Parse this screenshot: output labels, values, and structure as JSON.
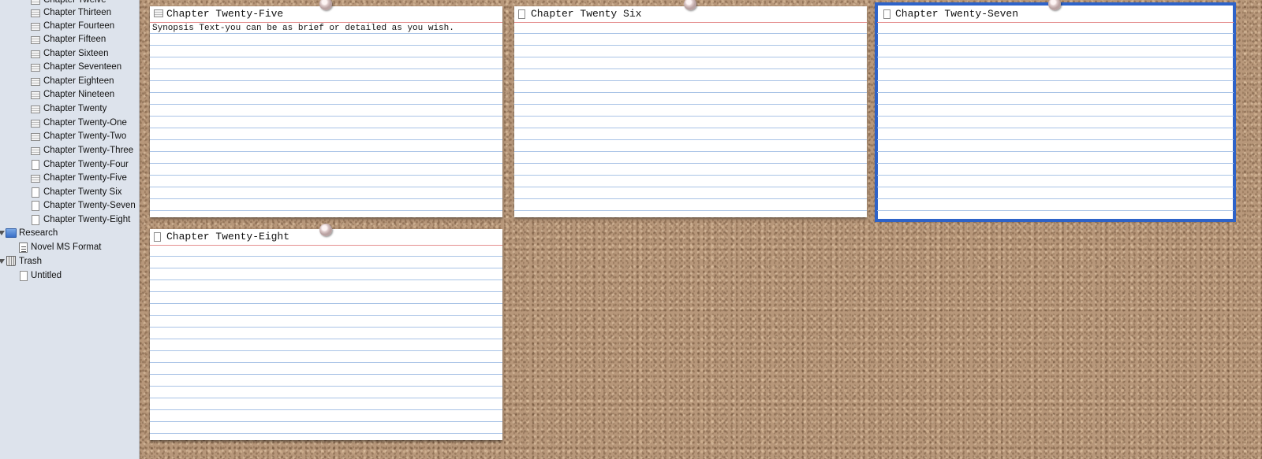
{
  "binder": {
    "items": [
      {
        "label": "Chapter Twelve",
        "icon": "document-lines-icon"
      },
      {
        "label": "Chapter Thirteen",
        "icon": "document-lines-icon"
      },
      {
        "label": "Chapter Fourteen",
        "icon": "document-lines-icon"
      },
      {
        "label": "Chapter Fifteen",
        "icon": "document-lines-icon"
      },
      {
        "label": "Chapter Sixteen",
        "icon": "document-lines-icon"
      },
      {
        "label": "Chapter Seventeen",
        "icon": "document-lines-icon"
      },
      {
        "label": "Chapter Eighteen",
        "icon": "document-lines-icon"
      },
      {
        "label": "Chapter Nineteen",
        "icon": "document-lines-icon"
      },
      {
        "label": "Chapter Twenty",
        "icon": "document-lines-icon"
      },
      {
        "label": "Chapter Twenty-One",
        "icon": "document-lines-icon"
      },
      {
        "label": "Chapter Twenty-Two",
        "icon": "document-lines-icon"
      },
      {
        "label": "Chapter Twenty-Three",
        "icon": "document-lines-icon"
      },
      {
        "label": "Chapter Twenty-Four",
        "icon": "blank-document-icon"
      },
      {
        "label": "Chapter Twenty-Five",
        "icon": "document-lines-icon"
      },
      {
        "label": "Chapter Twenty Six",
        "icon": "blank-document-icon"
      },
      {
        "label": "Chapter Twenty-Seven",
        "icon": "blank-document-icon"
      },
      {
        "label": "Chapter Twenty-Eight",
        "icon": "blank-document-icon"
      }
    ],
    "research": {
      "label": "Research",
      "icon": "research-folder-icon"
    },
    "research_children": [
      {
        "label": "Novel MS Format",
        "icon": "text-document-icon"
      }
    ],
    "trash": {
      "label": "Trash",
      "icon": "trash-icon"
    },
    "trash_children": [
      {
        "label": "Untitled",
        "icon": "blank-document-icon"
      }
    ]
  },
  "corkboard": {
    "cards": [
      {
        "title": "Chapter Twenty-Five",
        "synopsis": "Synopsis Text-you can be as brief or detailed as you wish.",
        "icon": "document-lines-icon",
        "selected": false
      },
      {
        "title": "Chapter Twenty Six",
        "synopsis": "",
        "icon": "blank-document-icon",
        "selected": false
      },
      {
        "title": "Chapter Twenty-Seven",
        "synopsis": "",
        "icon": "blank-document-icon",
        "selected": true
      },
      {
        "title": "Chapter Twenty-Eight",
        "synopsis": "",
        "icon": "blank-document-icon",
        "selected": false
      }
    ],
    "selection_color": "#2e63c9"
  }
}
